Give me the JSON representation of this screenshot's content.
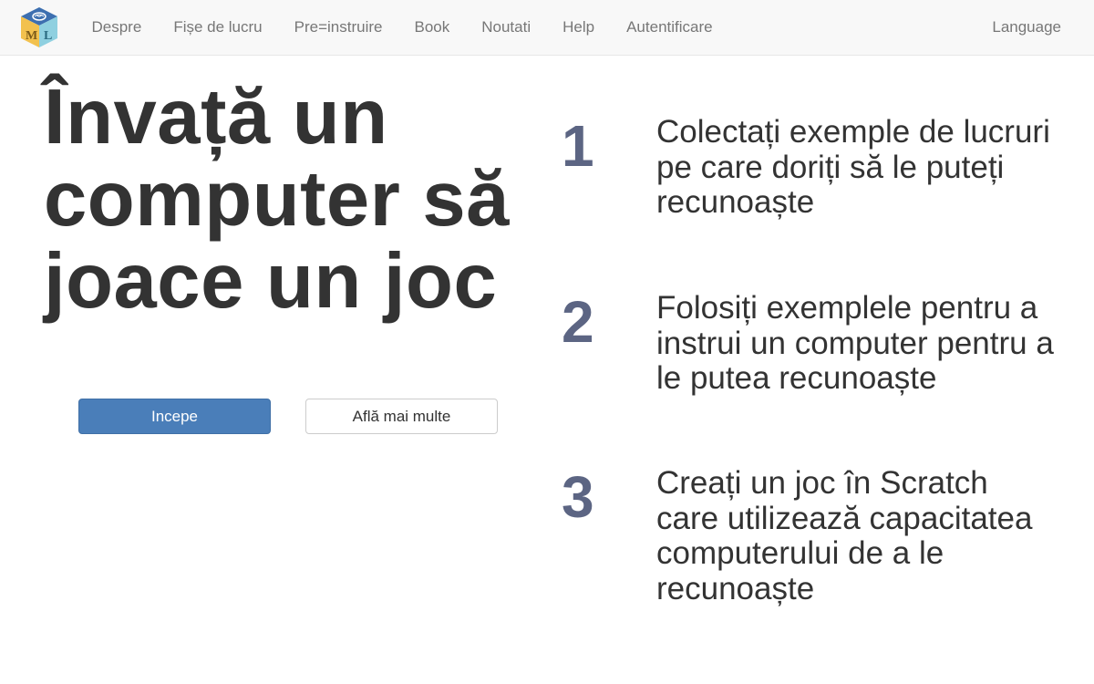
{
  "navbar": {
    "logo_letters": [
      "M",
      "L"
    ],
    "links": [
      {
        "label": "Despre"
      },
      {
        "label": "Fișe de lucru"
      },
      {
        "label": "Pre=instruire"
      },
      {
        "label": "Book"
      },
      {
        "label": "Noutati"
      },
      {
        "label": "Help"
      },
      {
        "label": "Autentificare"
      }
    ],
    "language_label": "Language"
  },
  "hero": {
    "title_lines": [
      "Învață un",
      "computer să",
      "joace un joc"
    ],
    "primary_button": "Incepe",
    "secondary_button": "Află mai multe"
  },
  "steps": [
    {
      "number": "1",
      "text": "Colectați exemple de lucruri pe care doriți să le puteți recunoaște"
    },
    {
      "number": "2",
      "text": "Folosiți exemplele pentru a instrui un computer pentru a le putea recunoaște"
    },
    {
      "number": "3",
      "text": "Creați un joc în Scratch care utilizează capacitatea computerului de a le recunoaște"
    }
  ],
  "colors": {
    "navbar_bg": "#f8f8f8",
    "nav_text": "#777777",
    "primary_button": "#4a7eb9",
    "step_number": "#5c6583",
    "heading_text": "#333333"
  }
}
